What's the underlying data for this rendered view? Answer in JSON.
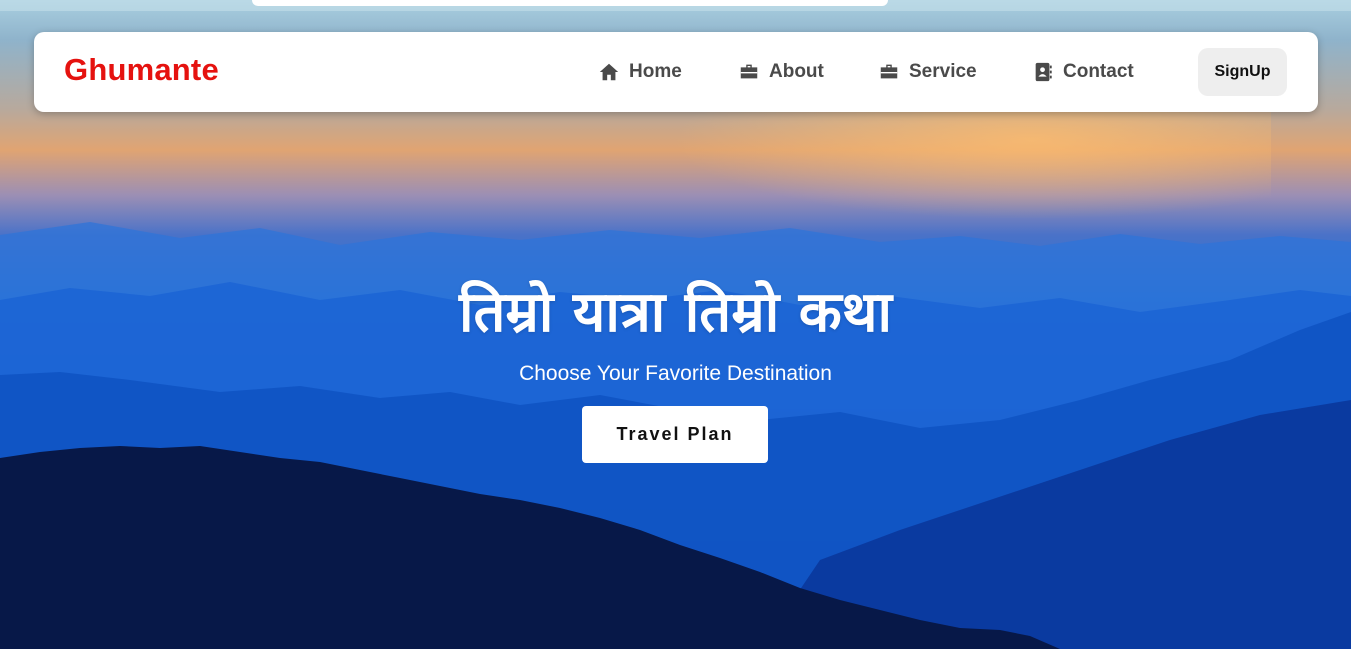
{
  "brand": {
    "name": "Ghumante",
    "color": "#e5120f"
  },
  "nav": {
    "items": [
      {
        "label": "Home",
        "icon": "home-icon"
      },
      {
        "label": "About",
        "icon": "briefcase-icon"
      },
      {
        "label": "Service",
        "icon": "briefcase-icon"
      },
      {
        "label": "Contact",
        "icon": "address-book-icon"
      }
    ],
    "signup_label": "SignUp"
  },
  "hero": {
    "headline": "तिम्रो यात्रा तिम्रो कथा",
    "subtitle": "Choose Your Favorite Destination",
    "cta_label": "Travel Plan"
  }
}
